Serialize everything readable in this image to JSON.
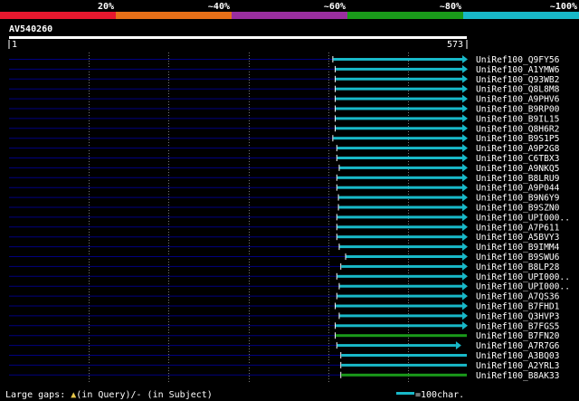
{
  "legend": {
    "segments": [
      {
        "label": "20%",
        "color": "#e8182e"
      },
      {
        "label": "~40%",
        "color": "#e87018"
      },
      {
        "label": "~60%",
        "color": "#9a2ea0"
      },
      {
        "label": "~80%",
        "color": "#1a9a1a"
      },
      {
        "label": "~100%",
        "color": "#18b8c8"
      }
    ]
  },
  "query": {
    "name": "AV540260",
    "start_label": "1",
    "end_label": "573",
    "length": 573
  },
  "colors": {
    "grid": "#dcdcdc",
    "gap_line": "#000080",
    "cyan": "#18b8c8",
    "green": "#1a9a1a"
  },
  "hits": [
    {
      "id": "UniRef100_Q9FY56",
      "start": 405,
      "end": 573,
      "color": "cyan",
      "arrow": true
    },
    {
      "id": "UniRef100_A1YMW6",
      "start": 408,
      "end": 573,
      "color": "cyan",
      "arrow": true
    },
    {
      "id": "UniRef100_Q93WB2",
      "start": 408,
      "end": 573,
      "color": "cyan",
      "arrow": true
    },
    {
      "id": "UniRef100_Q8L8M8",
      "start": 408,
      "end": 573,
      "color": "cyan",
      "arrow": true
    },
    {
      "id": "UniRef100_A9PHV6",
      "start": 408,
      "end": 573,
      "color": "cyan",
      "arrow": true
    },
    {
      "id": "UniRef100_B9RP00",
      "start": 408,
      "end": 573,
      "color": "cyan",
      "arrow": true
    },
    {
      "id": "UniRef100_B9IL15",
      "start": 408,
      "end": 573,
      "color": "cyan",
      "arrow": true
    },
    {
      "id": "UniRef100_Q8H6R2",
      "start": 408,
      "end": 573,
      "color": "cyan",
      "arrow": true
    },
    {
      "id": "UniRef100_B9S1P5",
      "start": 405,
      "end": 573,
      "color": "cyan",
      "arrow": true
    },
    {
      "id": "UniRef100_A9P2G8",
      "start": 410,
      "end": 573,
      "color": "cyan",
      "arrow": true
    },
    {
      "id": "UniRef100_C6TBX3",
      "start": 410,
      "end": 573,
      "color": "cyan",
      "arrow": true
    },
    {
      "id": "UniRef100_A9NKQ5",
      "start": 413,
      "end": 573,
      "color": "cyan",
      "arrow": true
    },
    {
      "id": "UniRef100_B8LRU9",
      "start": 410,
      "end": 573,
      "color": "cyan",
      "arrow": true
    },
    {
      "id": "UniRef100_A9P044",
      "start": 410,
      "end": 573,
      "color": "cyan",
      "arrow": true
    },
    {
      "id": "UniRef100_B9N6Y9",
      "start": 412,
      "end": 573,
      "color": "cyan",
      "arrow": true
    },
    {
      "id": "UniRef100_B9SZN0",
      "start": 412,
      "end": 573,
      "color": "cyan",
      "arrow": true
    },
    {
      "id": "UniRef100_UPI000..",
      "start": 410,
      "end": 573,
      "color": "cyan",
      "arrow": true
    },
    {
      "id": "UniRef100_A7P611",
      "start": 410,
      "end": 573,
      "color": "cyan",
      "arrow": true
    },
    {
      "id": "UniRef100_A5BVY3",
      "start": 410,
      "end": 573,
      "color": "cyan",
      "arrow": true
    },
    {
      "id": "UniRef100_B9IMM4",
      "start": 413,
      "end": 573,
      "color": "cyan",
      "arrow": true
    },
    {
      "id": "UniRef100_B9SWU6",
      "start": 421,
      "end": 573,
      "color": "cyan",
      "arrow": true
    },
    {
      "id": "UniRef100_B8LP28",
      "start": 415,
      "end": 573,
      "color": "cyan",
      "arrow": true
    },
    {
      "id": "UniRef100_UPI000..",
      "start": 410,
      "end": 573,
      "color": "cyan",
      "arrow": true
    },
    {
      "id": "UniRef100_UPI000..",
      "start": 413,
      "end": 573,
      "color": "cyan",
      "arrow": true
    },
    {
      "id": "UniRef100_A7QS36",
      "start": 410,
      "end": 573,
      "color": "cyan",
      "arrow": true
    },
    {
      "id": "UniRef100_B7FHD1",
      "start": 408,
      "end": 573,
      "color": "cyan",
      "arrow": true
    },
    {
      "id": "UniRef100_Q3HVP3",
      "start": 413,
      "end": 573,
      "color": "cyan",
      "arrow": true
    },
    {
      "id": "UniRef100_B7FGS5",
      "start": 408,
      "end": 573,
      "color": "cyan",
      "arrow": true
    },
    {
      "id": "UniRef100_B7FN20",
      "start": 408,
      "end": 573,
      "color": "green",
      "arrow": false
    },
    {
      "id": "UniRef100_A7R7G6",
      "start": 410,
      "end": 565,
      "color": "cyan",
      "arrow": true
    },
    {
      "id": "UniRef100_A3BQ03",
      "start": 415,
      "end": 573,
      "color": "cyan",
      "arrow": false
    },
    {
      "id": "UniRef100_A2YRL3",
      "start": 415,
      "end": 573,
      "color": "cyan",
      "arrow": false
    },
    {
      "id": "UniRef100_B8AK33",
      "start": 415,
      "end": 573,
      "color": "green",
      "arrow": false
    }
  ],
  "footer": {
    "gaps_prefix": "Large gaps: ",
    "gaps_icon": "▲",
    "gaps_text": "(in Query)/- (in Subject)",
    "scale_text": "=100char."
  }
}
